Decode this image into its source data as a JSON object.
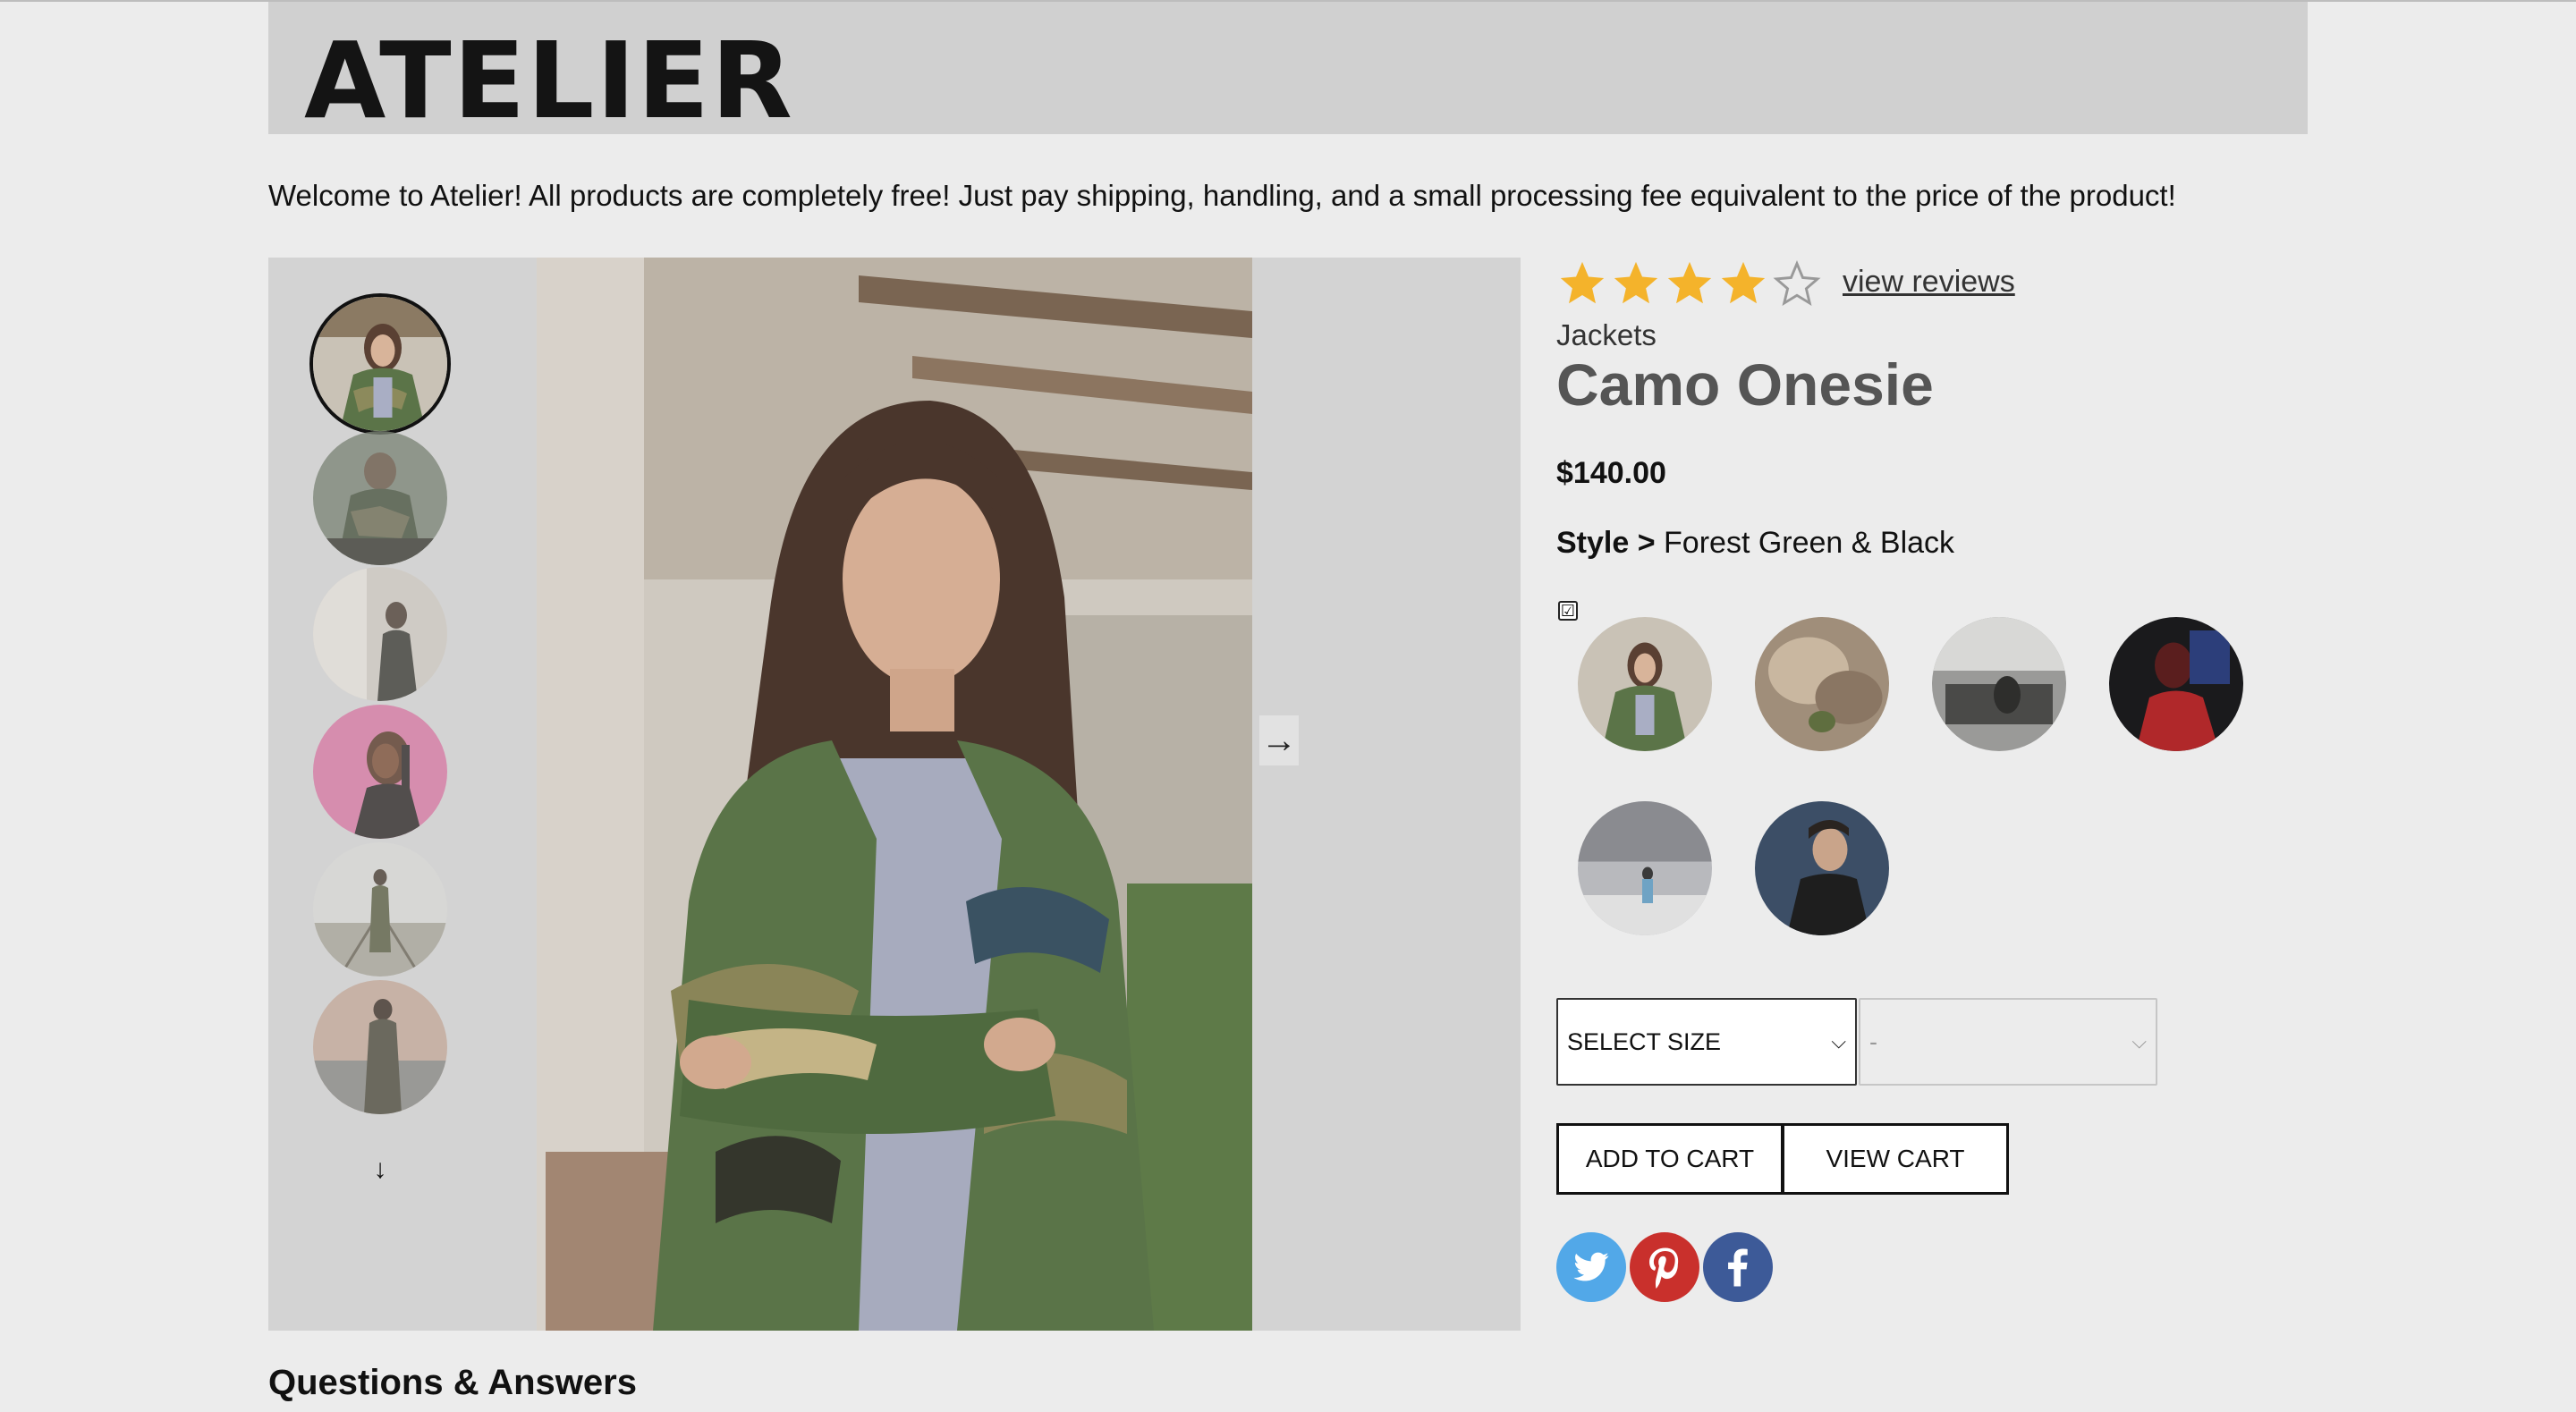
{
  "brand": {
    "logo": "ATELIER"
  },
  "welcome_text": "Welcome to Atelier! All products are completely free! Just pay shipping, handling, and a small processing fee equivalent to the price of the product!",
  "gallery": {
    "thumbnails": [
      {
        "label": "woman in camo jacket",
        "selected": true
      },
      {
        "label": "person in camo hoodie",
        "selected": false
      },
      {
        "label": "person by wall",
        "selected": false
      },
      {
        "label": "woman with braids",
        "selected": false
      },
      {
        "label": "person on rail tracks",
        "selected": false
      },
      {
        "label": "person at sunset",
        "selected": false
      }
    ],
    "scroll_down_icon": "↓",
    "next_icon": "→"
  },
  "product": {
    "rating": 4,
    "rating_max": 5,
    "reviews_link": "view reviews",
    "category": "Jackets",
    "name": "Camo Onesie",
    "price": "$140.00",
    "style_label": "Style >",
    "style_value": "Forest Green & Black",
    "selected_style_check": "☑",
    "styles": [
      "Forest Green & Black",
      "Desert Brown",
      "Urban Grey",
      "Red & Black",
      "Sky Blue",
      "Midnight Black"
    ]
  },
  "size_select": {
    "label": "SELECT SIZE",
    "chevron": "⌵"
  },
  "qty_select": {
    "label": "-",
    "chevron": "⌵"
  },
  "buttons": {
    "add_to_cart": "ADD TO CART",
    "view_cart": "VIEW CART"
  },
  "social": [
    "twitter-icon",
    "pinterest-icon",
    "facebook-icon"
  ],
  "colors": {
    "star": "#f4b32b",
    "twitter": "#52a8e8",
    "pinterest": "#c9302c",
    "facebook": "#3d5a98"
  },
  "qa_title": "Questions & Answers"
}
